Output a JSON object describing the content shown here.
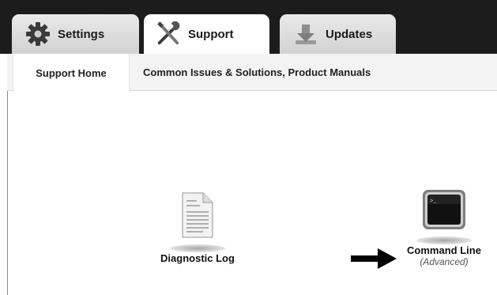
{
  "tabs": [
    {
      "label": "Settings",
      "icon": "gear-icon"
    },
    {
      "label": "Support",
      "icon": "tools-icon"
    },
    {
      "label": "Updates",
      "icon": "download-icon"
    }
  ],
  "subnav": {
    "support_home": "Support Home",
    "common_issues": "Common Issues & Solutions, Product Manuals"
  },
  "items": {
    "diagnostic_log": {
      "title": "Diagnostic Log",
      "icon": "document-icon"
    },
    "command_line": {
      "title": "Command Line",
      "subtitle": "(Advanced)",
      "icon": "terminal-icon"
    }
  },
  "colors": {
    "frame": "#1c1c1c",
    "tab_inactive": "#dcdcdc",
    "subnav_bg": "#f3f3f3"
  }
}
